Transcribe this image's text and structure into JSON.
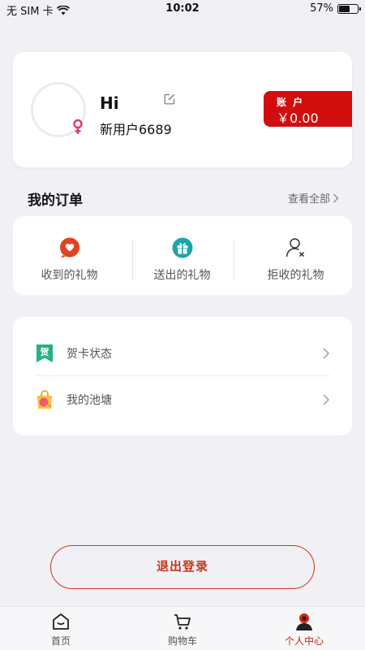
{
  "status_bar": {
    "carrier": "无 SIM 卡",
    "time": "10:02",
    "battery": "57%",
    "battery_level": 0.57
  },
  "profile": {
    "greeting": "Hi",
    "username": "新用户6689",
    "gender_icon": "female-icon",
    "account_label": "账 户",
    "account_amount": "￥0.00"
  },
  "orders": {
    "title": "我的订单",
    "view_all": "查看全部",
    "items": [
      {
        "label": "收到的礼物",
        "icon": "heart-bubble-icon"
      },
      {
        "label": "送出的礼物",
        "icon": "gift-icon"
      },
      {
        "label": "拒收的礼物",
        "icon": "user-reject-icon"
      }
    ]
  },
  "menu": {
    "items": [
      {
        "label": "贺卡状态",
        "icon": "greeting-card-icon",
        "icon_text": "贺"
      },
      {
        "label": "我的池塘",
        "icon": "pond-bag-icon"
      }
    ]
  },
  "logout": {
    "label": "退出登录"
  },
  "tabs": [
    {
      "label": "首页",
      "icon": "home-icon"
    },
    {
      "label": "购物车",
      "icon": "cart-icon"
    },
    {
      "label": "个人中心",
      "icon": "user-icon",
      "active": true
    }
  ],
  "colors": {
    "accent": "#d20d0d",
    "logout": "#c0391b",
    "active_tab": "#c8250f",
    "background": "#f1f0f5"
  }
}
